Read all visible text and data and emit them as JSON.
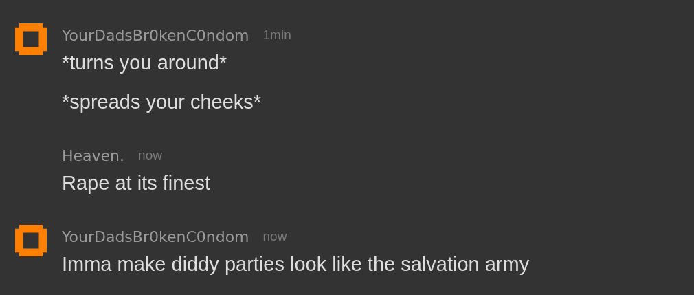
{
  "messages": [
    {
      "avatar": true,
      "username": "YourDadsBr0kenC0ndom",
      "time": "1min",
      "lines": [
        "*turns you around*",
        "*spreads your cheeks*"
      ]
    },
    {
      "avatar": false,
      "username": "Heaven.",
      "time": "now",
      "lines": [
        "Rape at its finest"
      ]
    },
    {
      "avatar": true,
      "username": "YourDadsBr0kenC0ndom",
      "time": "now",
      "lines": [
        "Imma make diddy parties look like the salvation army"
      ]
    }
  ]
}
